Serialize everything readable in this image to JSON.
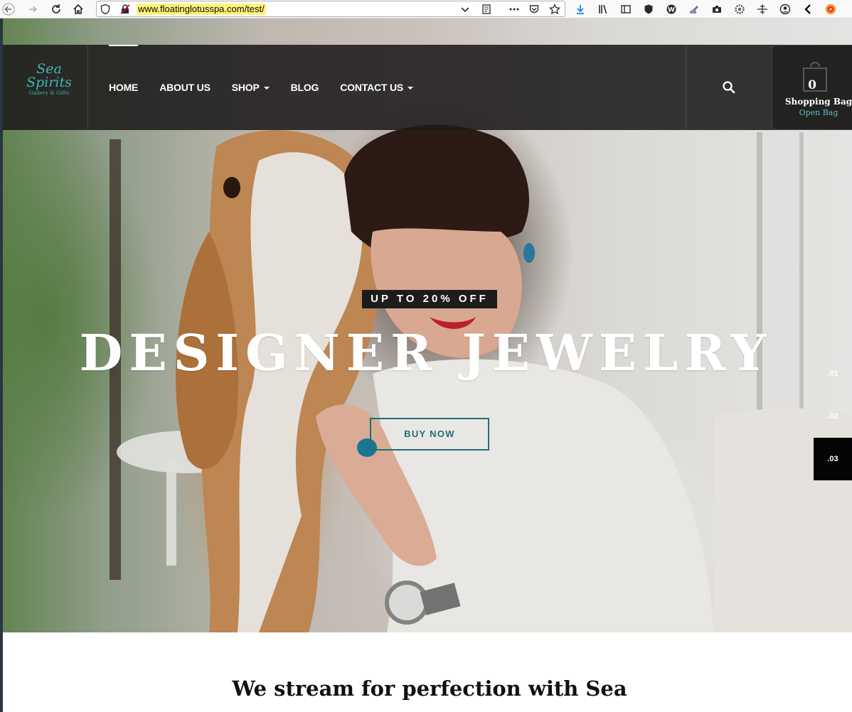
{
  "browser": {
    "url": "www.floatinglotusspa.com/test/",
    "icons": [
      "back-icon",
      "forward-icon",
      "reload-icon",
      "home-icon",
      "shield-icon",
      "insecure-lock-icon",
      "chevron-down-icon",
      "reader-view-icon",
      "more-icon",
      "pocket-icon",
      "bookmark-star-icon",
      "download-icon",
      "library-icon",
      "sidebar-icon",
      "privacy-shield-icon",
      "extension-icon",
      "screenshot-icon",
      "camera-icon",
      "gear-icon",
      "move-icon",
      "account-icon",
      "back-arrow-icon",
      "firefox-icon"
    ]
  },
  "header": {
    "logo": {
      "line1": "Sea",
      "line2": "Spirits",
      "sub": "Gallery & Gifts"
    },
    "nav": [
      {
        "label": "HOME",
        "active": true,
        "dropdown": false
      },
      {
        "label": "ABOUT US",
        "active": false,
        "dropdown": false
      },
      {
        "label": "SHOP",
        "active": false,
        "dropdown": true
      },
      {
        "label": "BLOG",
        "active": false,
        "dropdown": false
      },
      {
        "label": "CONTACT US",
        "active": false,
        "dropdown": true
      }
    ],
    "cart": {
      "count": "0",
      "label": "Shopping Bag",
      "link": "Open Bag"
    }
  },
  "hero": {
    "badge": "UP TO 20% OFF",
    "title": "DESIGNER JEWELRY",
    "button": "BUY NOW",
    "slides": [
      ".01",
      ".02",
      ".03"
    ],
    "active_slide": 2
  },
  "section": {
    "heading": "We stream for perfection with Sea"
  },
  "colors": {
    "accent": "#1f6f72",
    "teal_link": "#4fc3c8",
    "header_bg": "#1c1a1a",
    "logo": "#3fb6b8"
  }
}
